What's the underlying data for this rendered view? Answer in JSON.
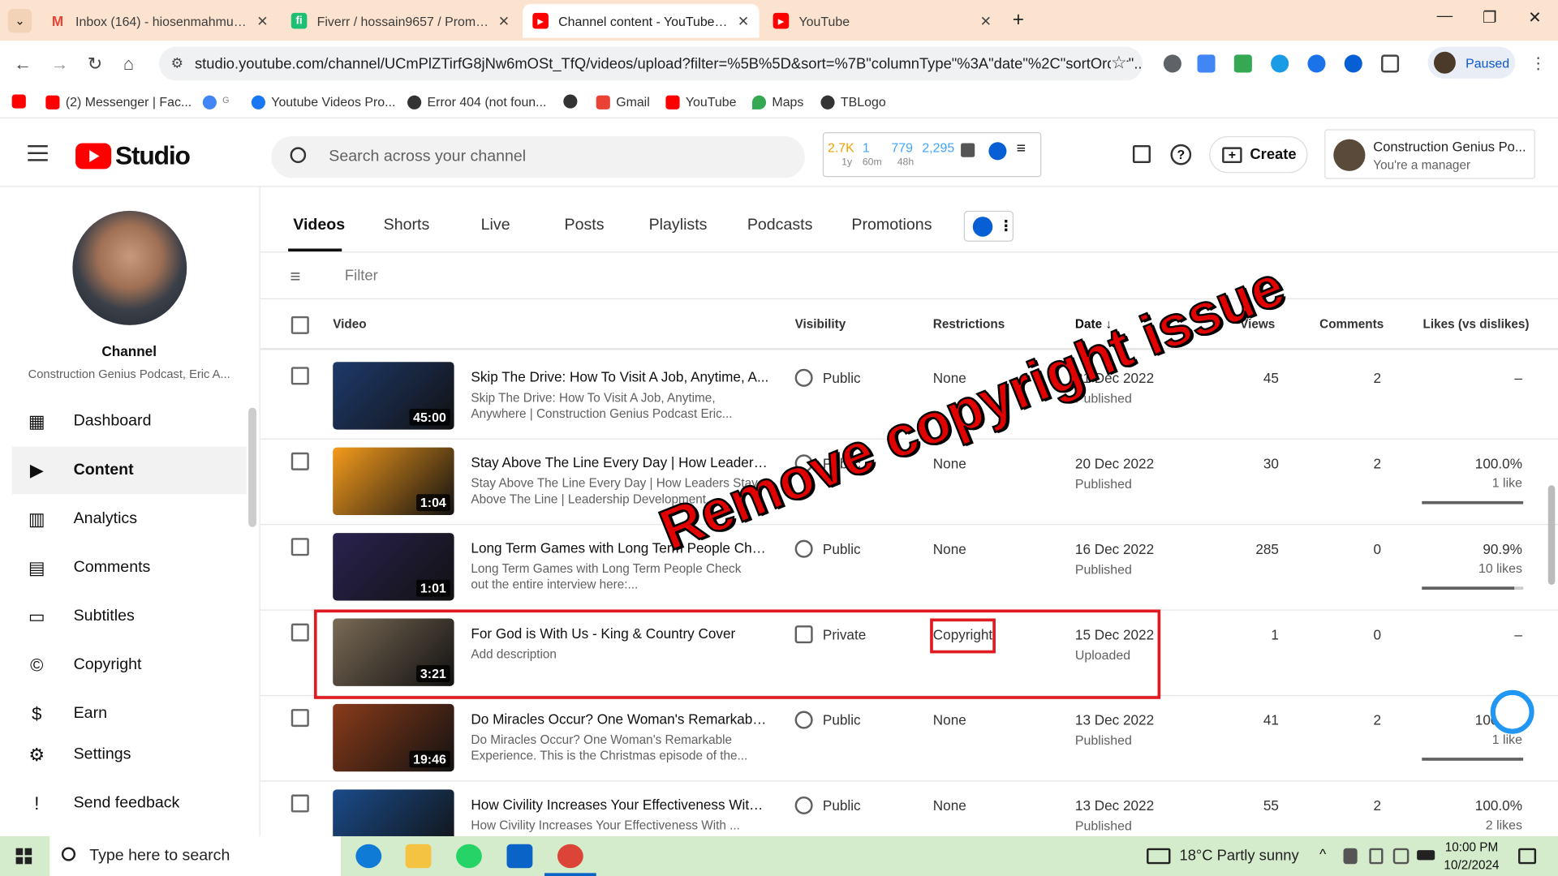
{
  "browser": {
    "tabs": [
      {
        "title": "Inbox (164) - hiosenmahmud@",
        "fav": "M",
        "color": "#ea4335"
      },
      {
        "title": "Fiverr / hossain9657 / Promote",
        "fav": "fi",
        "color": "#1dbf73"
      },
      {
        "title": "Channel content - YouTube Stu",
        "fav": "▶",
        "color": "#ff0000"
      },
      {
        "title": "YouTube",
        "fav": "▶",
        "color": "#ff0000"
      }
    ],
    "url": "studio.youtube.com/channel/UCmPlZTirfG8jNw6mOSt_TfQ/videos/upload?filter=%5B%5D&sort=%7B\"columnType\"%3A\"date\"%2C\"sortOrder\"...",
    "profile_label": "Paused",
    "bookmarks": [
      {
        "label": "(2) Messenger | Fac...",
        "color": "#ff0000"
      },
      {
        "label": "Youtube Videos Pro...",
        "color": "#1877f2"
      },
      {
        "label": "Error 404 (not foun...",
        "color": "#333"
      },
      {
        "label": "Gmail",
        "color": "#ea4335"
      },
      {
        "label": "YouTube",
        "color": "#ff0000"
      },
      {
        "label": "Maps",
        "color": "#34a853"
      },
      {
        "label": "TBLogo",
        "color": "#333"
      }
    ]
  },
  "studio": {
    "logo_text": "Studio",
    "search_placeholder": "Search across your channel",
    "stats": {
      "subs": "2.7K",
      "subs_period": "1y",
      "realtime": "1",
      "realtime_period": "60m",
      "views": "779",
      "views_period": "48h",
      "total": "2,295"
    },
    "create_label": "Create",
    "account_name": "Construction Genius Po...",
    "account_role": "You're a manager"
  },
  "sidebar": {
    "channel_label": "Channel",
    "channel_name": "Construction Genius Podcast, Eric A...",
    "items": [
      {
        "label": "Dashboard",
        "icon": "dashboard-icon"
      },
      {
        "label": "Content",
        "icon": "content-icon"
      },
      {
        "label": "Analytics",
        "icon": "analytics-icon"
      },
      {
        "label": "Comments",
        "icon": "comments-icon"
      },
      {
        "label": "Subtitles",
        "icon": "subtitles-icon"
      },
      {
        "label": "Copyright",
        "icon": "copyright-icon"
      },
      {
        "label": "Earn",
        "icon": "earn-icon"
      },
      {
        "label": "Settings",
        "icon": "settings-icon"
      },
      {
        "label": "Send feedback",
        "icon": "feedback-icon"
      }
    ]
  },
  "content": {
    "tabs": [
      "Videos",
      "Shorts",
      "Live",
      "Posts",
      "Playlists",
      "Podcasts",
      "Promotions"
    ],
    "filter_placeholder": "Filter",
    "columns": {
      "video": "Video",
      "visibility": "Visibility",
      "restrictions": "Restrictions",
      "date": "Date",
      "views": "Views",
      "comments": "Comments",
      "likes": "Likes (vs dislikes)"
    },
    "rows": [
      {
        "title": "Skip The Drive: How To Visit A Job, Anytime, A...",
        "desc": "Skip The Drive: How To Visit A Job, Anytime, Anywhere | Construction Genius Podcast Eric...",
        "duration": "45:00",
        "visibility": "Public",
        "restriction": "None",
        "date": "21 Dec 2022",
        "status": "Published",
        "views": "45",
        "comments": "2",
        "likes_pct": "–",
        "likes_count": "",
        "like_fraction": 0,
        "thumb": "#1e3a6b"
      },
      {
        "title": "Stay Above The Line Every Day | How Leaders ...",
        "desc": "Stay Above The Line Every Day | How Leaders Stay Above The Line | Leadership Development...",
        "duration": "1:04",
        "visibility": "Public",
        "restriction": "None",
        "date": "20 Dec 2022",
        "status": "Published",
        "views": "30",
        "comments": "2",
        "likes_pct": "100.0%",
        "likes_count": "1 like",
        "like_fraction": 1.0,
        "thumb": "#f59b1c"
      },
      {
        "title": "Long Term Games with Long Term People Check",
        "desc": "Long Term Games with Long Term People Check out the entire interview here:...",
        "duration": "1:01",
        "visibility": "Public",
        "restriction": "None",
        "date": "16 Dec 2022",
        "status": "Published",
        "views": "285",
        "comments": "0",
        "likes_pct": "90.9%",
        "likes_count": "10 likes",
        "like_fraction": 0.909,
        "thumb": "#2a2250"
      },
      {
        "title": "For God is With Us - King & Country Cover",
        "desc": "Add description",
        "duration": "3:21",
        "visibility": "Private",
        "restriction": "Copyright",
        "date": "15 Dec 2022",
        "status": "Uploaded",
        "views": "1",
        "comments": "0",
        "likes_pct": "–",
        "likes_count": "",
        "like_fraction": 0,
        "thumb": "#7a6a55"
      },
      {
        "title": "Do Miracles Occur? One Woman's Remarkable ...",
        "desc": "Do Miracles Occur? One Woman's Remarkable Experience. This is the Christmas episode of the...",
        "duration": "19:46",
        "visibility": "Public",
        "restriction": "None",
        "date": "13 Dec 2022",
        "status": "Published",
        "views": "41",
        "comments": "2",
        "likes_pct": "100.0%",
        "likes_count": "1 like",
        "like_fraction": 1.0,
        "thumb": "#8a3b1a"
      },
      {
        "title": "How Civility Increases Your Effectiveness With ...",
        "desc": "How Civility Increases Your Effectiveness With ...",
        "duration": "",
        "visibility": "Public",
        "restriction": "None",
        "date": "13 Dec 2022",
        "status": "Published",
        "views": "55",
        "comments": "2",
        "likes_pct": "100.0%",
        "likes_count": "2 likes",
        "like_fraction": 1.0,
        "thumb": "#1a4b8a"
      }
    ]
  },
  "overlay_text": "Remove copyright issue",
  "taskbar": {
    "search_placeholder": "Type here to search",
    "weather": "18°C  Partly sunny",
    "time": "10:00 PM",
    "date": "10/2/2024"
  }
}
